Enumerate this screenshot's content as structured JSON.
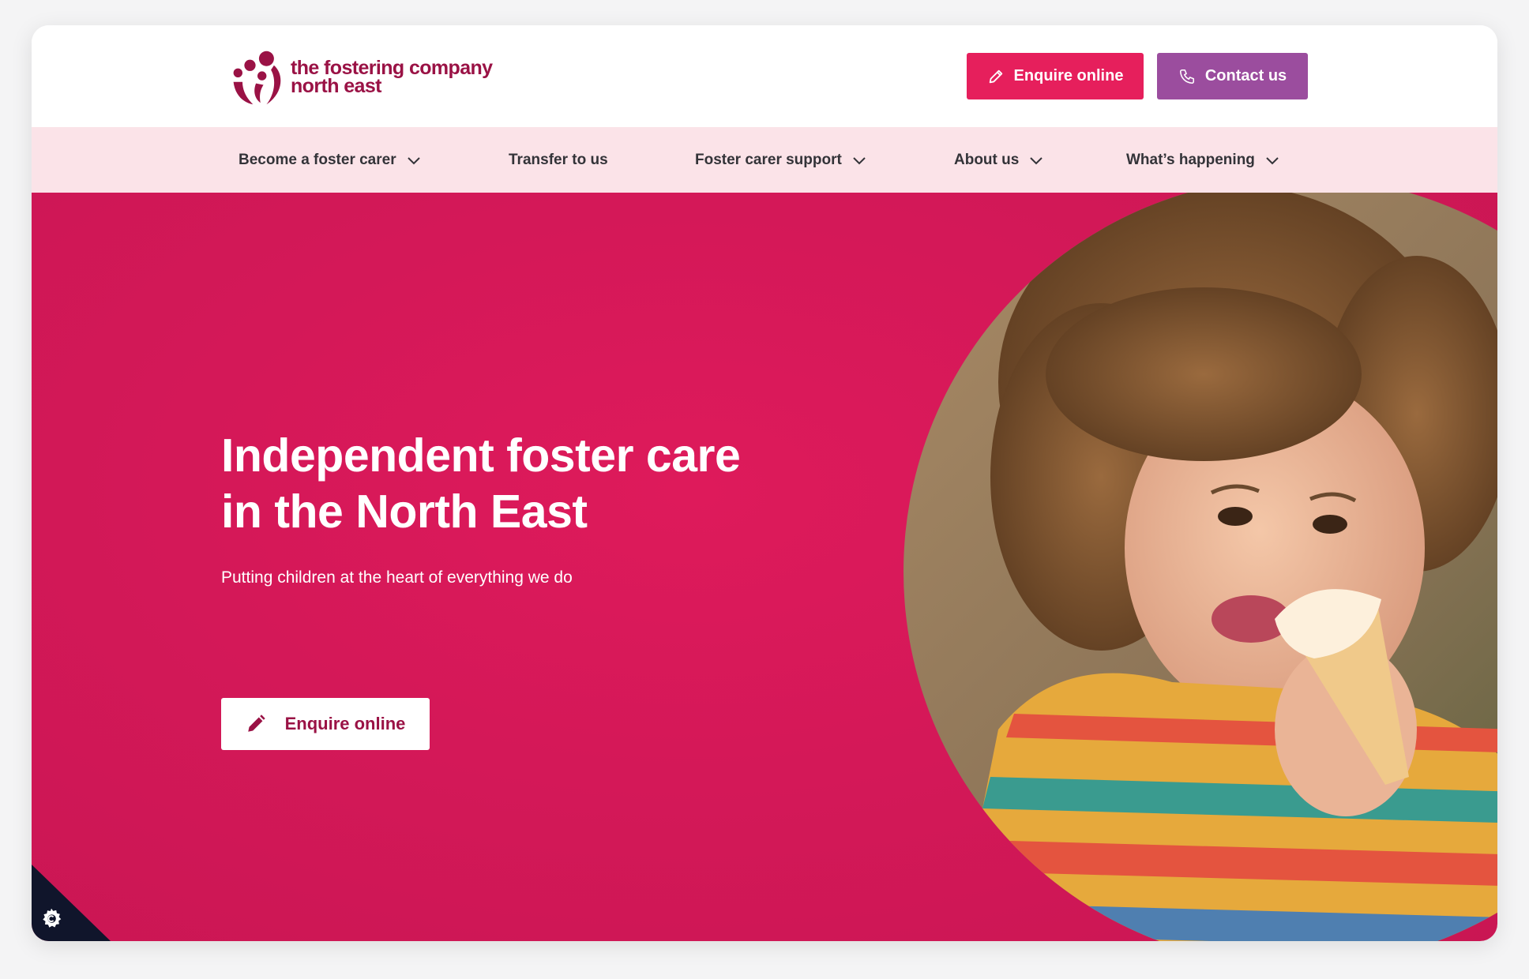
{
  "brand": {
    "name_line1": "the fostering company",
    "name_line2": "north east",
    "color": "#9a1245"
  },
  "header": {
    "enquire_label": "Enquire online",
    "enquire_icon": "pencil-icon",
    "enquire_color": "#e61f5c",
    "contact_label": "Contact us",
    "contact_icon": "phone-icon",
    "contact_color": "#9b4d9e"
  },
  "nav": {
    "items": [
      {
        "label": "Become a foster carer",
        "has_dropdown": true
      },
      {
        "label": "Transfer to us",
        "has_dropdown": false
      },
      {
        "label": "Foster carer support",
        "has_dropdown": true
      },
      {
        "label": "About us",
        "has_dropdown": true
      },
      {
        "label": "What’s happening",
        "has_dropdown": true
      }
    ],
    "background": "#fbe3e8"
  },
  "hero": {
    "title_line1": "Independent foster care",
    "title_line2": "in the North East",
    "subtitle": "Putting children at the heart of everything we do",
    "cta_label": "Enquire online",
    "cta_icon": "pencil-icon",
    "background": "#d41858",
    "image": "child-eating-ice-cream-photo"
  },
  "cookie_settings": {
    "icon": "gear-icon"
  }
}
